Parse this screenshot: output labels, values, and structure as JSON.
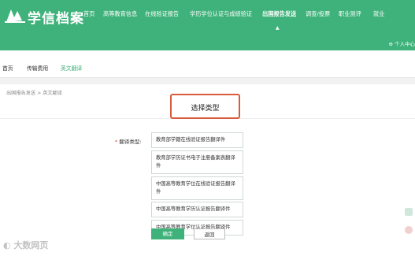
{
  "header": {
    "brand": "学信档案",
    "nav": [
      {
        "label": "首页",
        "active": false
      },
      {
        "label": "高等教育信息",
        "active": false
      },
      {
        "label": "在线验证报告",
        "active": false
      },
      {
        "label": "学历学位认证与成绩验证",
        "active": false
      },
      {
        "label": "出国报告发送",
        "active": true
      },
      {
        "label": "调查/投票",
        "active": false
      },
      {
        "label": "职业测评",
        "active": false
      },
      {
        "label": "就业",
        "active": false
      }
    ],
    "user_label": "个人中心",
    "colors": {
      "brand": "#3eb27a"
    }
  },
  "subnav": [
    "首页",
    "传输费用",
    "英文翻译"
  ],
  "breadcrumb": "出国报告发送 > 英文翻译",
  "title": "选择类型",
  "form": {
    "required_mark": "*",
    "label": "翻译类型:",
    "options": [
      "教育部学籍在线验证报告翻译件",
      "教育部学历证书电子注册备案表翻译件",
      "中国高等教育学位在线验证报告翻译件",
      "中国高等教育学历认证报告翻译件",
      "中国高等教育学位认证报告翻译件"
    ],
    "confirm_label": "确定",
    "back_label": "返回"
  },
  "watermark": "大数网页"
}
